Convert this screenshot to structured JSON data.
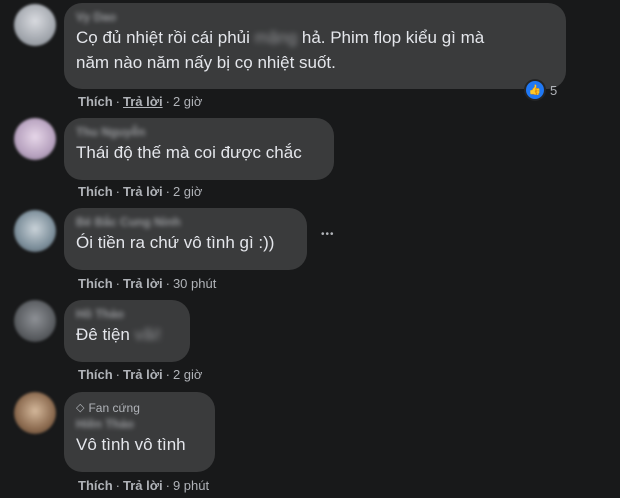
{
  "comments": [
    {
      "author": "Vy Dao",
      "text_a": "Cọ đủ nhiệt rồi cái phủi ",
      "text_hidden": "mặng",
      "text_b": " hả. Phim flop kiểu gì mà",
      "text_line2": "năm nào năm nấy bị cọ nhiệt suốt.",
      "like": "Thích",
      "reply": "Trả lời",
      "time": "2 giờ",
      "reaction_count": "5",
      "avatar_color": "#9a9fa6"
    },
    {
      "author": "Thu Nguyễn",
      "text": "Thái độ thế mà coi được chắc",
      "like": "Thích",
      "reply": "Trả lời",
      "time": "2 giờ",
      "avatar_color": "#b7a2bf"
    },
    {
      "author": "Bé Bắc Cung Ninh",
      "text": "Ói tiền ra chứ vô tình gì :))",
      "like": "Thích",
      "reply": "Trả lời",
      "time": "30 phút",
      "avatar_color": "#7d8f9b"
    },
    {
      "author": "Hồ Thảo",
      "text": "Đê tiện ",
      "text_hidden": "vãi!",
      "like": "Thích",
      "reply": "Trả lời",
      "time": "2 giờ",
      "avatar_color": "#5a5d61"
    },
    {
      "badge": "Fan cứng",
      "author": "Hiền Thảo",
      "text": "Vô tình vô tình",
      "like": "Thích",
      "reply": "Trả lời",
      "time": "9 phút",
      "avatar_color": "#8b6a4f"
    }
  ],
  "more_label": "•••"
}
